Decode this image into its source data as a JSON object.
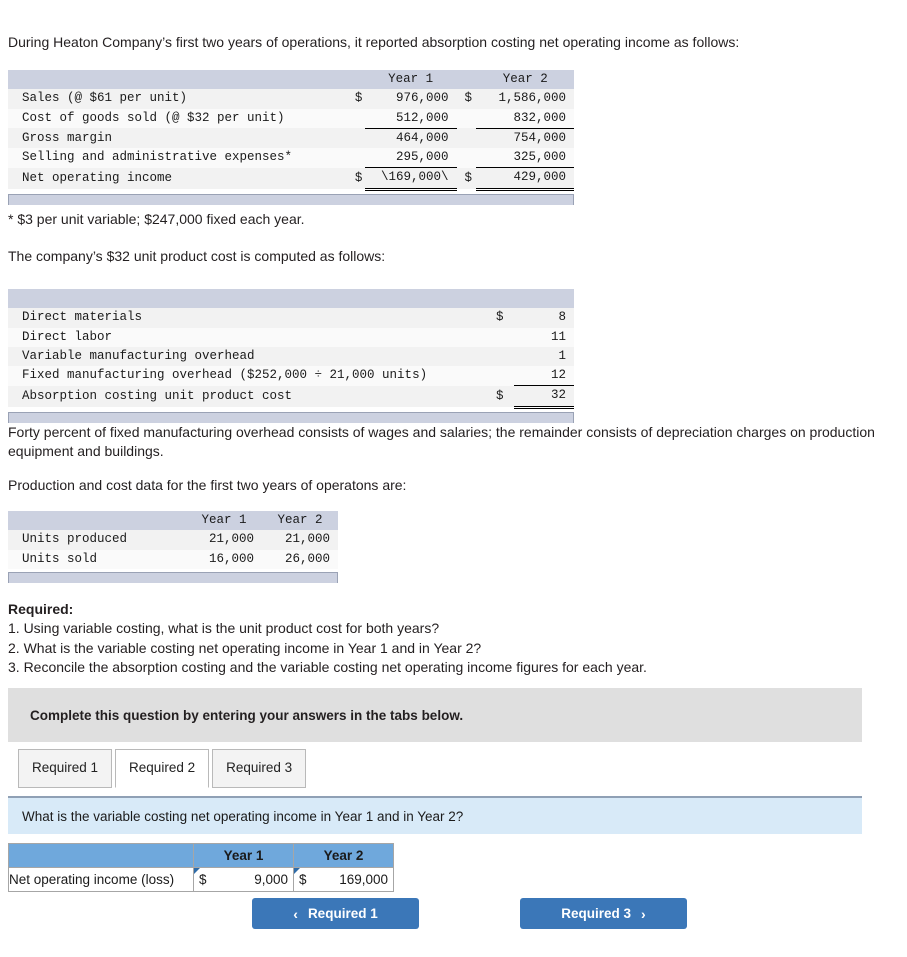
{
  "intro": {
    "paragraph": "During Heaton Company’s first two years of operations, it reported absorption costing net operating income as follows:"
  },
  "income_table": {
    "headers": [
      "",
      "Year 1",
      "Year 2"
    ],
    "rows": [
      {
        "label": "Sales (@ $61 per unit)",
        "y1_cur": "$",
        "y1": "976,000",
        "y2_cur": "$",
        "y2": "1,586,000"
      },
      {
        "label": "Cost of goods sold (@ $32 per unit)",
        "y1_cur": "",
        "y1": "512,000",
        "y2_cur": "",
        "y2": "832,000"
      },
      {
        "label": "Gross margin",
        "y1_cur": "",
        "y1": "464,000",
        "y2_cur": "",
        "y2": "754,000"
      },
      {
        "label": "Selling and administrative expenses*",
        "y1_cur": "",
        "y1": "295,000",
        "y2_cur": "",
        "y2": "325,000"
      },
      {
        "label": "Net operating income",
        "y1_cur": "$",
        "y1": "\\169,000\\",
        "y2_cur": "$",
        "y2": "429,000"
      }
    ]
  },
  "footnote": "* $3 per unit variable; $247,000 fixed each year.",
  "unitcost_intro": "The company’s $32 unit product cost is computed as follows:",
  "unitcost_table": {
    "rows": [
      {
        "label": "Direct materials",
        "cur": "$",
        "value": "8"
      },
      {
        "label": "Direct labor",
        "cur": "",
        "value": "11"
      },
      {
        "label": "Variable manufacturing overhead",
        "cur": "",
        "value": "1"
      },
      {
        "label": "Fixed manufacturing overhead ($252,000 ÷ 21,000 units)",
        "cur": "",
        "value": "12"
      },
      {
        "label": "Absorption costing unit product cost",
        "cur": "$",
        "value": "32"
      }
    ]
  },
  "forty_percent": "Forty percent of fixed manufacturing overhead consists of wages and salaries; the remainder consists of depreciation charges on production equipment and buildings.",
  "production_intro": "Production and cost data for the first two years of operatons are:",
  "production_table": {
    "headers": [
      "",
      "Year 1",
      "Year 2"
    ],
    "rows": [
      {
        "label": "Units produced",
        "y1": "21,000",
        "y2": "21,000"
      },
      {
        "label": "Units sold",
        "y1": "16,000",
        "y2": "26,000"
      }
    ]
  },
  "required": {
    "title": "Required:",
    "items": [
      "1. Using variable costing, what is the unit product cost for both years?",
      "2. What is the variable costing net operating income in Year 1 and in Year 2?",
      "3. Reconcile the absorption costing and the variable costing net operating income figures for each year."
    ]
  },
  "banner": {
    "text": "Complete this question by entering your answers in the tabs below."
  },
  "tabs": [
    {
      "label": "Required 1",
      "active": false
    },
    {
      "label": "Required 2",
      "active": true
    },
    {
      "label": "Required 3",
      "active": false
    }
  ],
  "question_bar": {
    "text": "What is the variable costing net operating income in Year 1 and in Year 2?"
  },
  "answer_table": {
    "headers": [
      "",
      "Year 1",
      "Year 2"
    ],
    "row_label": "Net operating income (loss)",
    "year1": {
      "currency": "$",
      "value": "9,000"
    },
    "year2": {
      "currency": "$",
      "value": "169,000"
    }
  },
  "nav": {
    "prev_label": "Required 1",
    "prev_icon": "chevron-left-icon",
    "next_label": "Required 3",
    "next_icon": "chevron-right-icon",
    "chev_left": "‹",
    "chev_right": "›"
  },
  "colors": {
    "table_header_bg": "#ccd1e0",
    "banner_bg": "#dfdfdf",
    "question_bar_bg": "#d8eaf8",
    "answer_header_bg": "#6fa8dc",
    "button_bg": "#3b77b8",
    "input_border": "#2f6ca8"
  }
}
